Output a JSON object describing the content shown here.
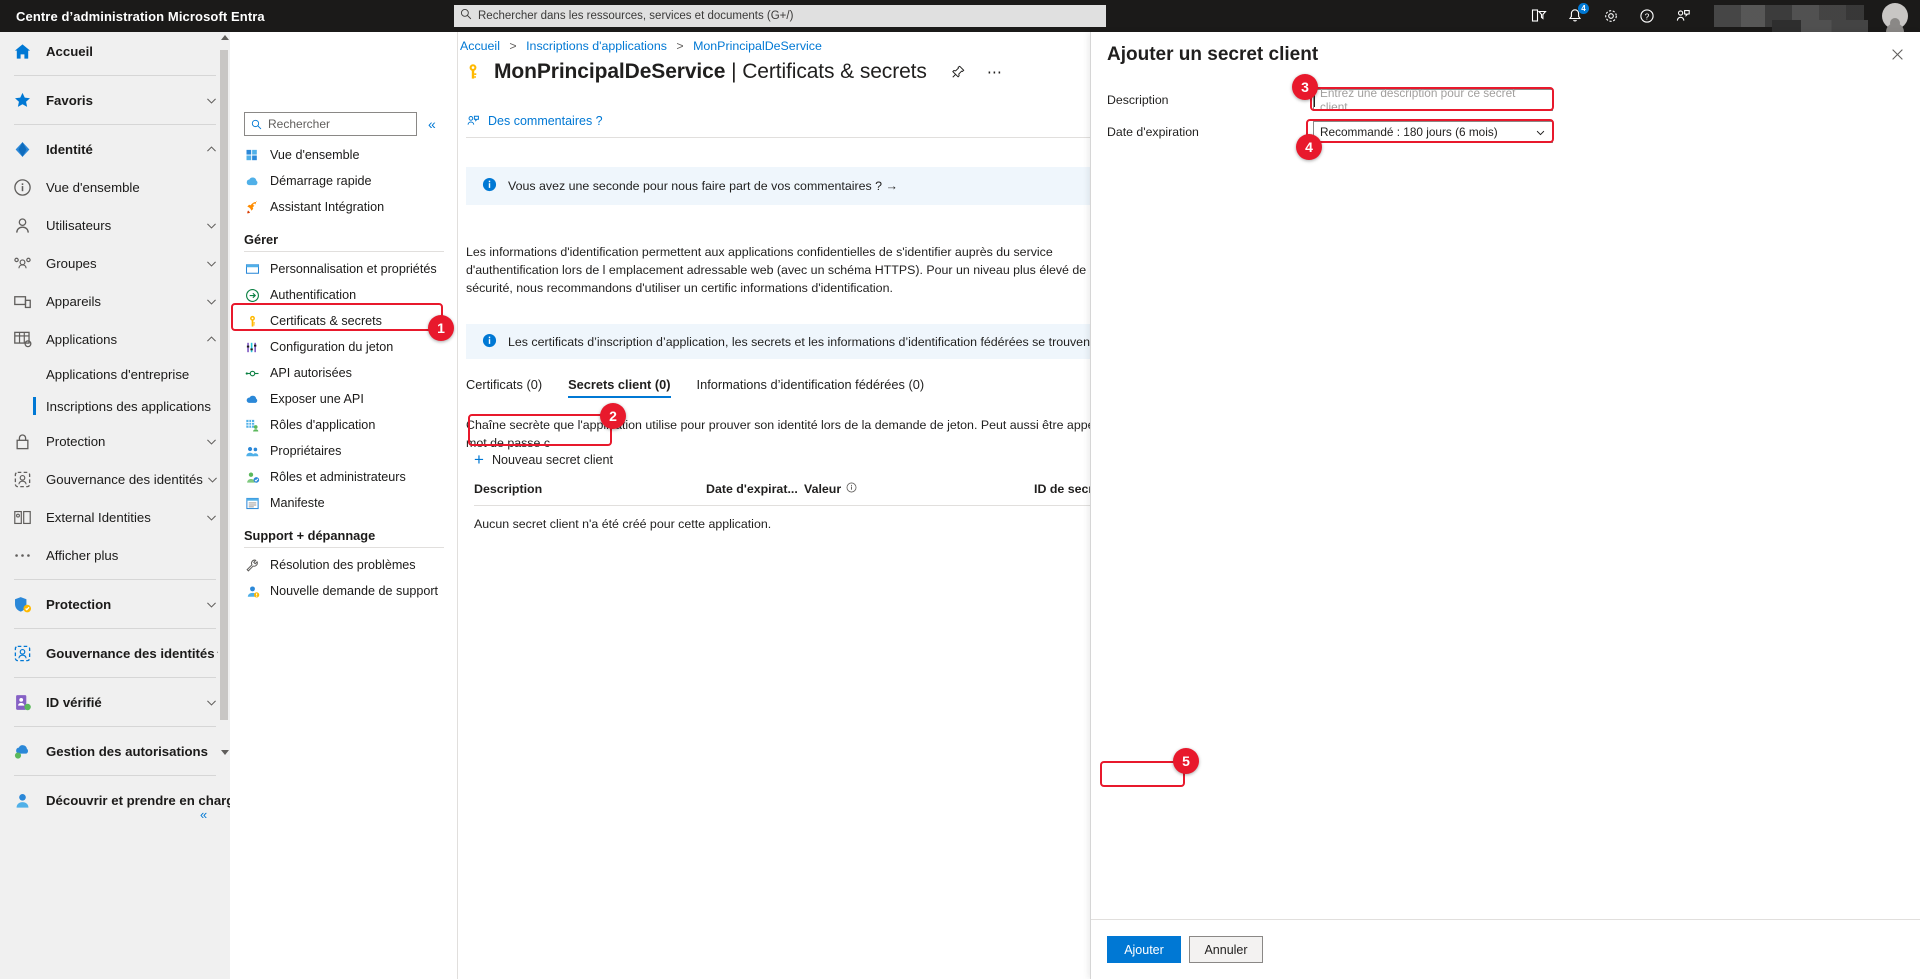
{
  "topbar": {
    "title": "Centre d’administration Microsoft Entra",
    "search_placeholder": "Rechercher dans les ressources, services et documents (G+/)",
    "search_icon": "search-icon",
    "icons": [
      {
        "name": "directories-filter-icon",
        "badge": ""
      },
      {
        "name": "notifications-bell-icon",
        "badge": "4"
      },
      {
        "name": "settings-gear-icon",
        "badge": ""
      },
      {
        "name": "help-question-icon",
        "badge": ""
      },
      {
        "name": "feedback-person-icon",
        "badge": ""
      }
    ]
  },
  "sidebar": {
    "items": [
      {
        "label": "Accueil",
        "icon": "home-icon",
        "chevron": "",
        "bold": true,
        "divider_after": true
      },
      {
        "label": "Favoris",
        "icon": "star-icon",
        "chevron": "down",
        "bold": true,
        "divider_after": true
      },
      {
        "label": "Identité",
        "icon": "entra-diamond-icon",
        "chevron": "up",
        "bold": true,
        "divider_after": false
      },
      {
        "label": "Vue d'ensemble",
        "icon": "info-circle-icon",
        "chevron": "",
        "bold": false,
        "divider_after": false
      },
      {
        "label": "Utilisateurs",
        "icon": "user-icon",
        "chevron": "down",
        "bold": false,
        "divider_after": false
      },
      {
        "label": "Groupes",
        "icon": "groups-icon",
        "chevron": "down",
        "bold": false,
        "divider_after": false
      },
      {
        "label": "Appareils",
        "icon": "devices-icon",
        "chevron": "down",
        "bold": false,
        "divider_after": false
      },
      {
        "label": "Applications",
        "icon": "applications-grid-icon",
        "chevron": "up",
        "bold": false,
        "divider_after": false
      }
    ],
    "app_subitems": [
      {
        "label": "Applications d'entreprise",
        "selected": false
      },
      {
        "label": "Inscriptions des applications",
        "selected": true
      }
    ],
    "items2": [
      {
        "label": "Protection",
        "icon": "lock-icon",
        "chevron": "down",
        "bold": false,
        "divider_after": false
      },
      {
        "label": "Gouvernance des identités",
        "icon": "governance-icon",
        "chevron": "down",
        "bold": false,
        "divider_after": false
      },
      {
        "label": "External Identities",
        "icon": "external-identities-icon",
        "chevron": "down",
        "bold": false,
        "divider_after": false
      },
      {
        "label": "Afficher plus",
        "icon": "ellipsis-icon",
        "chevron": "",
        "bold": false,
        "divider_after": true
      },
      {
        "label": "Protection",
        "icon": "protection-shield-icon",
        "chevron": "down",
        "bold": true,
        "divider_after": true
      },
      {
        "label": "Gouvernance des identités",
        "icon": "governance-blue-icon",
        "chevron": "down",
        "bold": true,
        "divider_after": true
      },
      {
        "label": "ID vérifié",
        "icon": "verified-id-icon",
        "chevron": "down",
        "bold": true,
        "divider_after": true
      },
      {
        "label": "Gestion des autorisations",
        "icon": "permissions-cloud-icon",
        "chevron": "",
        "bold": true,
        "divider_after": true
      },
      {
        "label": "Découvrir et prendre en charge",
        "icon": "discover-person-icon",
        "chevron": "up",
        "bold": true,
        "divider_after": false
      }
    ],
    "collapse_label": "«"
  },
  "resource_menu": {
    "search_placeholder": "Rechercher",
    "search_icon": "search-icon",
    "collapse_icon": "collapse-left-icon",
    "items": [
      {
        "label": "Vue d'ensemble",
        "icon": "overview-grid-icon"
      },
      {
        "label": "Démarrage rapide",
        "icon": "quickstart-cloud-icon"
      },
      {
        "label": "Assistant Intégration",
        "icon": "rocket-icon"
      }
    ],
    "group_manage": "Gérer",
    "manage_items": [
      {
        "label": "Personnalisation et propriétés",
        "icon": "branding-icon",
        "highlighted": false
      },
      {
        "label": "Authentification",
        "icon": "authentication-icon",
        "highlighted": false
      },
      {
        "label": "Certificats & secrets",
        "icon": "key-icon",
        "highlighted": true
      },
      {
        "label": "Configuration du jeton",
        "icon": "token-config-icon",
        "highlighted": false
      },
      {
        "label": "API autorisées",
        "icon": "api-permissions-icon",
        "highlighted": false
      },
      {
        "label": "Exposer une API",
        "icon": "expose-api-icon",
        "highlighted": false
      },
      {
        "label": "Rôles d'application",
        "icon": "app-roles-icon",
        "highlighted": false
      },
      {
        "label": "Propriétaires",
        "icon": "owners-icon",
        "highlighted": false
      },
      {
        "label": "Rôles et administrateurs",
        "icon": "roles-admins-icon",
        "highlighted": false
      },
      {
        "label": "Manifeste",
        "icon": "manifest-icon",
        "highlighted": false
      }
    ],
    "group_support": "Support + dépannage",
    "support_items": [
      {
        "label": "Résolution des problèmes",
        "icon": "troubleshoot-icon"
      },
      {
        "label": "Nouvelle demande de support",
        "icon": "support-request-icon"
      }
    ]
  },
  "main": {
    "breadcrumb": [
      {
        "label": "Accueil",
        "link": true
      },
      {
        "label": "Inscriptions d'applications",
        "link": true
      },
      {
        "label": "MonPrincipalDeService",
        "link": true
      }
    ],
    "breadcrumb_separator": "›",
    "page_icon": "key-icon",
    "page_title_app": "MonPrincipalDeService",
    "page_title_section": "Certificats & secrets",
    "page_title_divider": "|",
    "pin_icon": "pin-icon",
    "more_icon": "ellipsis-icon",
    "feedback_label": "Des commentaires ?",
    "feedback_icon": "feedback-person-icon",
    "infobar1": "Vous avez une seconde pour nous faire part de vos commentaires ? →",
    "description": "Les informations d'identification permettent aux applications confidentielles de s'identifier auprès du service d'authentification lors de l emplacement adressable web (avec un schéma HTTPS). Pour un niveau plus élevé de sécurité, nous recommandons d'utiliser un certific informations d'identification.",
    "infobar2": "Les certificats d’inscription d’application, les secrets et les informations d’identification fédérées se trouvent dans les onglets ci-dessous.",
    "tabs": [
      {
        "label": "Certificats (0)",
        "active": false
      },
      {
        "label": "Secrets client (0)",
        "active": true
      },
      {
        "label": "Informations d’identification fédérées (0)",
        "active": false
      }
    ],
    "tab_description": "Chaîne secrète que l'application utilise pour prouver son identité lors de la demande de jeton. Peut aussi être appelée mot de passe c",
    "new_secret_button": "Nouveau secret client",
    "new_secret_icon": "plus-icon",
    "table": {
      "columns": [
        "Description",
        "Date d'expirat...",
        "Valeur",
        "ID de secr"
      ],
      "value_info_icon": "info-circle-icon",
      "empty_message": "Aucun secret client n'a été créé pour cette application."
    }
  },
  "panel": {
    "title": "Ajouter un secret client",
    "close_icon": "close-icon",
    "fields": [
      {
        "label": "Description",
        "name": "description-field",
        "placeholder": "Entrez une description pour ce secret client",
        "value": "",
        "type": "text"
      },
      {
        "label": "Date d'expiration",
        "name": "expiration-select",
        "value": "Recommandé : 180 jours (6 mois)",
        "type": "select",
        "chevron_icon": "chevron-down-icon"
      }
    ],
    "submit_label": "Ajouter",
    "cancel_label": "Annuler"
  },
  "annotations": [
    {
      "number": "1",
      "target": "certificats-et-secrets-menu-item"
    },
    {
      "number": "2",
      "target": "nouveau-secret-client-button"
    },
    {
      "number": "3",
      "target": "description-field"
    },
    {
      "number": "4",
      "target": "expiration-select"
    },
    {
      "number": "5",
      "target": "ajouter-button"
    }
  ],
  "colors": {
    "accent": "#0078d4",
    "topbar_bg": "#1b1a19",
    "annotation_red": "#e8192c",
    "info_bg": "#eff6fc"
  }
}
